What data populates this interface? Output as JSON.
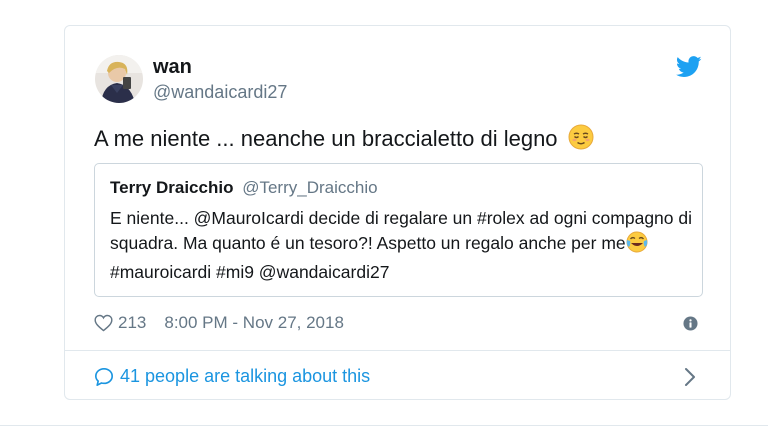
{
  "tweet": {
    "display_name": "wan",
    "handle": "@wandaicardi27",
    "text": "A me niente ... neanche un braccialetto di legno",
    "text_emoji": "relieved-face-emoji",
    "quote": {
      "name": "Terry Draicchio",
      "handle": "@Terry_Draicchio",
      "text_part1": "E niente... @MauroIcardi decide di regalare un #rolex ad ogni compagno di squadra. Ma quanto é un tesoro?! Aspetto un regalo anche per me",
      "text_emoji": "face-with-tears-of-joy-emoji",
      "text_part2": " #mauroicardi #mi9 @wandaicardi27"
    },
    "likes": "213",
    "timestamp": "8:00 PM - Nov 27, 2018",
    "talking": "41 people are talking about this"
  },
  "colors": {
    "twitter_blue": "#1da1f2",
    "link_blue": "#1b95e0",
    "secondary_text": "#657786",
    "border": "#e1e8ed"
  },
  "icons": [
    "twitter-bird-icon",
    "heart-icon",
    "info-icon",
    "speech-bubble-icon",
    "chevron-right-icon"
  ]
}
